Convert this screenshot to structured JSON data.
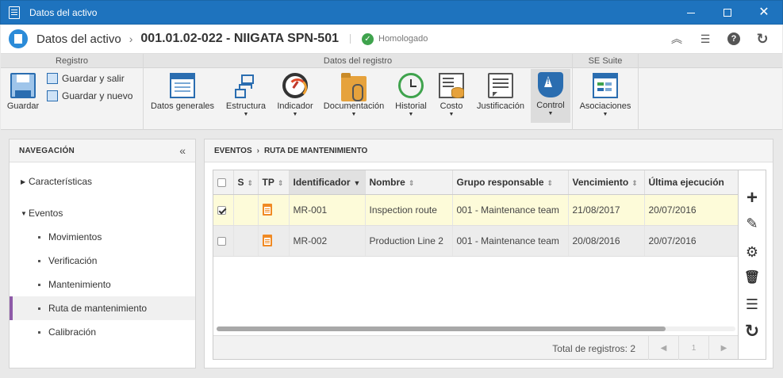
{
  "window": {
    "title": "Datos del activo",
    "minimize_icon": "minimize-icon",
    "maximize_icon": "maximize-icon",
    "close_glyph": "✕"
  },
  "header": {
    "root": "Datos del activo",
    "separator": "›",
    "current": "001.01.02-022 - NIIGATA SPN-501",
    "status": "Homologado",
    "status_color": "#3fa34d",
    "actions": [
      "collapse-up-icon",
      "list-icon",
      "help-icon",
      "refresh-icon"
    ],
    "help_glyph": "?"
  },
  "ribbon": {
    "groups": {
      "registro": "Registro",
      "datos": "Datos del registro",
      "suite": "SE Suite"
    },
    "save": "Guardar",
    "save_exit": "Guardar y salir",
    "save_new": "Guardar y nuevo",
    "buttons": {
      "datos_generales": "Datos generales",
      "estructura": "Estructura",
      "indicador": "Indicador",
      "documentacion": "Documentación",
      "historial": "Historial",
      "costo": "Costo",
      "justificacion": "Justificación",
      "control": "Control",
      "asociaciones": "Asociaciones"
    },
    "caret": "▼"
  },
  "nav": {
    "title": "NAVEGACIÓN",
    "collapse_glyph": "«",
    "items": {
      "caracteristicas": "Características",
      "eventos": "Eventos",
      "movimientos": "Movimientos",
      "verificacion": "Verificación",
      "mantenimiento": "Mantenimiento",
      "ruta": "Ruta de mantenimiento",
      "calibracion": "Calibración"
    },
    "arrow_right": "▶",
    "arrow_down": "▼",
    "accent_color": "#8e5aa8"
  },
  "main": {
    "breadcrumb": {
      "root": "EVENTOS",
      "separator": "›",
      "current": "RUTA DE MANTENIMIENTO"
    },
    "grid": {
      "columns": {
        "s": "S",
        "tp": "TP",
        "identificador": "Identificador",
        "nombre": "Nombre",
        "grupo": "Grupo responsable",
        "vencimiento": "Vencimiento",
        "ultima": "Última ejecución"
      },
      "sort_glyph": "⇕",
      "sort_active_glyph": "▼",
      "rows": [
        {
          "checked": true,
          "id": "MR-001",
          "nombre": "Inspection route",
          "grupo": "001 - Maintenance team",
          "vencimiento": "21/08/2017",
          "ultima": "20/07/2016"
        },
        {
          "checked": false,
          "id": "MR-002",
          "nombre": "Production Line 2",
          "grupo": "001 - Maintenance team",
          "vencimiento": "20/08/2016",
          "ultima": "20/07/2016"
        }
      ],
      "total": "Total de registros: 2",
      "page": "1",
      "prev_glyph": "◀",
      "next_glyph": "▶"
    },
    "tools": {
      "add": "+",
      "edit": "✎",
      "config": "⚙",
      "delete": "🗑",
      "list": "☰",
      "refresh": "↻"
    }
  }
}
